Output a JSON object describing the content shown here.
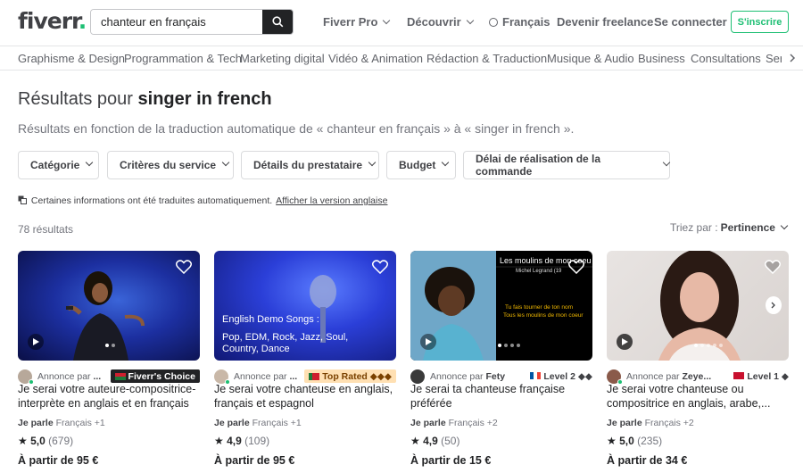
{
  "header": {
    "logo_text": "fiverr",
    "logo_dot": ".",
    "search_value": "chanteur en français",
    "nav": {
      "pro": "Fiverr Pro",
      "discover": "Découvrir",
      "language": "Français",
      "become_freelancer": "Devenir freelance",
      "sign_in": "Se connecter",
      "join": "S'inscrire"
    }
  },
  "categories": [
    "Graphisme & Design",
    "Programmation & Tech",
    "Marketing digital",
    "Vidéo & Animation",
    "Rédaction & Traduction",
    "Musique & Audio",
    "Business",
    "Consultations",
    "Serv"
  ],
  "results": {
    "title_prefix": "Résultats pour",
    "query": "singer in french",
    "subtitle": "Résultats en fonction de la traduction automatique de « chanteur en français » à « singer in french ».",
    "filters": [
      "Catégorie",
      "Critères du service",
      "Détails du prestataire",
      "Budget",
      "Délai de réalisation de la commande"
    ],
    "translate_note": "Certaines informations ont été traduites automatiquement.",
    "translate_link": "Afficher la version anglaise",
    "count": "78 résultats",
    "sort_label": "Triez par :",
    "sort_value": "Pertinence"
  },
  "gigs": [
    {
      "seller_prefix": "Annonce par",
      "seller_name": "...",
      "badge": "Fiverr's Choice",
      "title": "Je serai votre auteure-compositrice-interprète en anglais et en français",
      "lang_label": "Je parle",
      "lang_value": "Français +1",
      "rating": "5,0",
      "reviews": "(679)",
      "price": "À partir de 95 €"
    },
    {
      "seller_prefix": "Annonce par",
      "seller_name": "...",
      "badge": "Top Rated ◆◆◆",
      "title": "Je serai votre chanteuse en anglais, français et espagnol",
      "lang_label": "Je parle",
      "lang_value": "Français +1",
      "rating": "4,9",
      "reviews": "(109)",
      "price": "À partir de 95 €",
      "thumb_text": "English Demo Songs : Pop, EDM, Rock, Jazz, Soul, Country, Dance"
    },
    {
      "seller_prefix": "Annonce par",
      "seller_name": "Fety",
      "badge": "Level 2 ◆◆",
      "title": "Je serai ta chanteuse française préférée",
      "lang_label": "Je parle",
      "lang_value": "Français +2",
      "rating": "4,9",
      "reviews": "(50)",
      "price": "À partir de 15 €",
      "thumb_title": "Les moulins de mon coeu",
      "thumb_artist": "Michel Legrand (19",
      "thumb_lyric1": "Tu fais tourner de ton nom",
      "thumb_lyric2": "Tous les moulins de mon coeur"
    },
    {
      "seller_prefix": "Annonce par",
      "seller_name": "Zeye...",
      "badge": "Level 1 ◆",
      "title": "Je serai votre chanteuse ou compositrice en anglais, arabe,...",
      "lang_label": "Je parle",
      "lang_value": "Français +2",
      "rating": "5,0",
      "reviews": "(235)",
      "price": "À partir de 34 €"
    }
  ],
  "colors": {
    "brand_green": "#1dbf73",
    "text": "#404145",
    "star": "#222325"
  }
}
